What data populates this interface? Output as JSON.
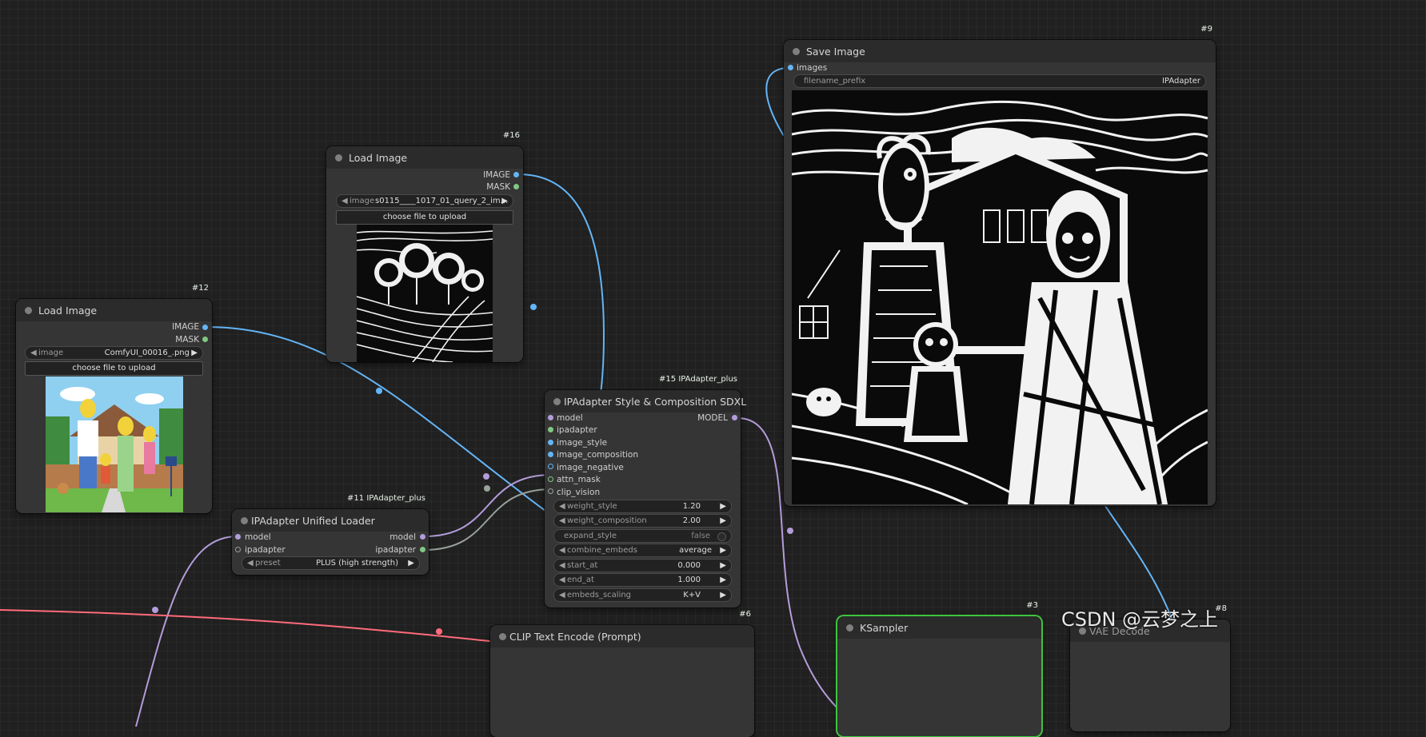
{
  "nodes": {
    "save_image": {
      "title": "Save Image",
      "id": "#9",
      "input_images": "images",
      "filename_prefix_label": "filename_prefix",
      "filename_prefix_value": "IPAdapter"
    },
    "load_image_16": {
      "title": "Load Image",
      "id": "#16",
      "out_image": "IMAGE",
      "out_mask": "MASK",
      "image_label": "image",
      "image_value": "s0115____1017_01_query_2_im...",
      "upload_label": "choose file to upload"
    },
    "load_image_12": {
      "title": "Load Image",
      "id": "#12",
      "out_image": "IMAGE",
      "out_mask": "MASK",
      "image_label": "image",
      "image_value": "ComfyUI_00016_.png",
      "upload_label": "choose file to upload"
    },
    "ipadapter_style": {
      "title": "IPAdapter Style & Composition SDXL",
      "id": "#15 IPAdapter_plus",
      "inputs": [
        "model",
        "ipadapter",
        "image_style",
        "image_composition",
        "image_negative",
        "attn_mask",
        "clip_vision"
      ],
      "output": "MODEL",
      "widgets": [
        {
          "label": "weight_style",
          "value": "1.20"
        },
        {
          "label": "weight_composition",
          "value": "2.00"
        },
        {
          "label": "expand_style",
          "value": "false"
        },
        {
          "label": "combine_embeds",
          "value": "average"
        },
        {
          "label": "start_at",
          "value": "0.000"
        },
        {
          "label": "end_at",
          "value": "1.000"
        },
        {
          "label": "embeds_scaling",
          "value": "K+V"
        }
      ]
    },
    "unified_loader": {
      "title": "IPAdapter Unified Loader",
      "id": "#11 IPAdapter_plus",
      "in_model": "model",
      "in_ipadapter": "ipadapter",
      "out_model": "model",
      "out_ipadapter": "ipadapter",
      "preset_label": "preset",
      "preset_value": "PLUS (high strength)"
    },
    "clip_text_encode": {
      "title": "CLIP Text Encode (Prompt)",
      "id": "#6"
    },
    "ksampler": {
      "title": "KSampler",
      "id": "#3"
    },
    "vae_decode": {
      "title": "VAE Decode",
      "id": "#8"
    }
  },
  "watermark": "CSDN @云梦之上",
  "colors": {
    "canvas": "#202020",
    "node_body": "#353535",
    "node_header": "#2b2b2b",
    "image_link": "#64b5f6",
    "model_link": "#b39ddb",
    "clip_link": "#ff6b7a",
    "ipadapter_link": "#9aa39a",
    "mask_dot": "#81c784",
    "selected_outline": "#3ec53e"
  }
}
